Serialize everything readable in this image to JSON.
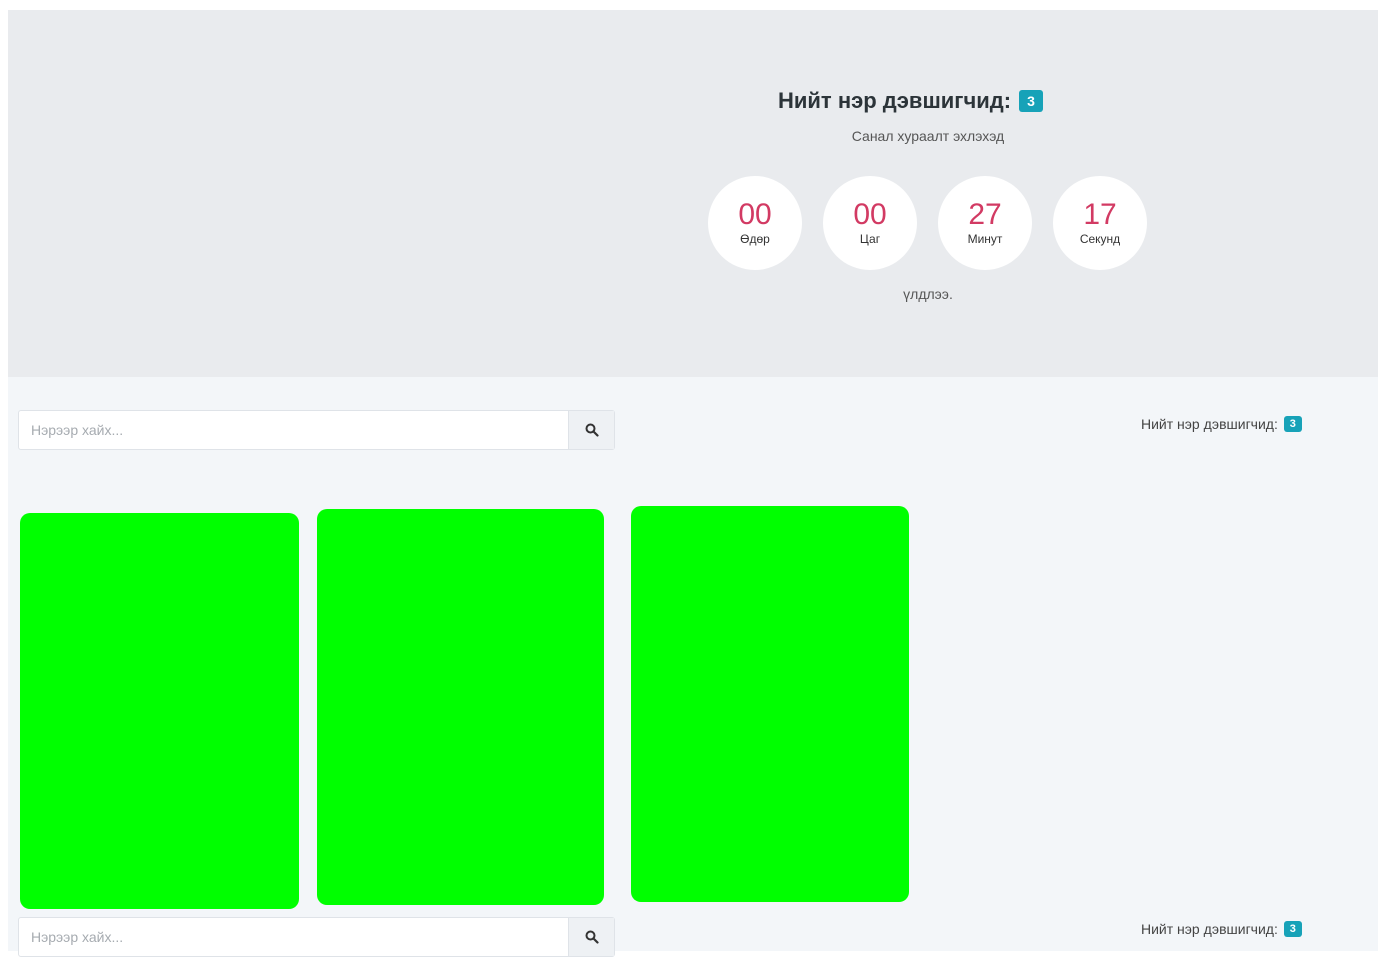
{
  "hero": {
    "title": "Нийт нэр дэвшигчид:",
    "count": "3",
    "subtitle": "Санал хураалт эхлэхэд",
    "countdown": [
      {
        "value": "00",
        "label": "Өдөр"
      },
      {
        "value": "00",
        "label": "Цаг"
      },
      {
        "value": "27",
        "label": "Минут"
      },
      {
        "value": "17",
        "label": "Секунд"
      }
    ],
    "after_text": "үлдлээ."
  },
  "toolbar": {
    "search_placeholder": "Нэрээр хайх...",
    "count_label": "Нийт нэр дэвшигчид:",
    "count": "3"
  },
  "colors": {
    "accent": "#17a2b8",
    "countdown_number": "#d23a63",
    "card_fill": "#00ff00"
  },
  "icons": {
    "search": "search-icon"
  }
}
